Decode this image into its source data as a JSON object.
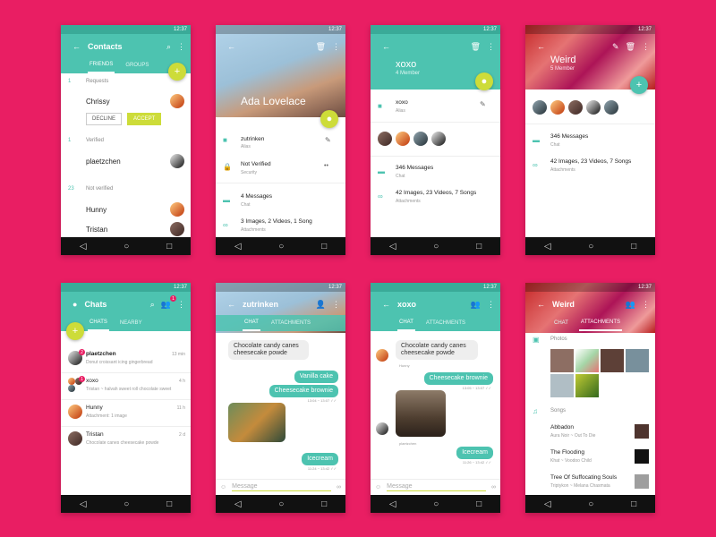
{
  "colors": {
    "bg": "#E91E63",
    "primary": "#4DC3B0",
    "accent": "#CDDC39",
    "nav": "#111111"
  },
  "time": "12:37",
  "nav": {
    "back": "◁",
    "home": "○",
    "recent": "□"
  },
  "s1": {
    "title": "Contacts",
    "tabs": [
      "FRIENDS",
      "GROUPS"
    ],
    "req_count": "1",
    "req_label": "Requests",
    "req_name": "Chrissy",
    "decline": "DECLINE",
    "accept": "ACCEPT",
    "ver_count": "1",
    "ver_label": "Verified",
    "ver_name": "plaetzchen",
    "nv_count": "23",
    "nv_label": "Not verified",
    "nv_names": [
      "Hunny",
      "Tristan"
    ]
  },
  "s2": {
    "name": "Ada Lovelace",
    "rows": [
      {
        "t": "zutrinken",
        "s": "Alias"
      },
      {
        "t": "Not Verified",
        "s": "Security"
      },
      {
        "t": "4 Messages",
        "s": "Chat"
      },
      {
        "t": "3 Images, 2 Videos, 1 Song",
        "s": "Attachments"
      }
    ]
  },
  "s3": {
    "title": "xoxo",
    "sub": "4 Member",
    "alias": {
      "t": "xoxo",
      "s": "Alias"
    },
    "chat": {
      "t": "346 Messages",
      "s": "Chat"
    },
    "att": {
      "t": "42 Images, 23 Videos, 7 Songs",
      "s": "Attachments"
    }
  },
  "s4": {
    "title": "Weird",
    "sub": "5 Member",
    "chat": {
      "t": "346 Messages",
      "s": "Chat"
    },
    "att": {
      "t": "42 Images, 23 Videos, 7 Songs",
      "s": "Attachments"
    }
  },
  "s5": {
    "title": "Chats",
    "tabs": [
      "CHATS",
      "NEARBY"
    ],
    "badge": "1",
    "items": [
      {
        "name": "plaetzchen",
        "msg": "Donut croissant icing gingerbread",
        "time": "13 min",
        "badge": "2"
      },
      {
        "name": "xoxo",
        "msg": "Tristan ~ halvah sweet roll chocolate sweet",
        "time": "4 h",
        "badge": "1"
      },
      {
        "name": "Hunny",
        "msg": "Attachment: 1 image",
        "time": "11 h",
        "badge": ""
      },
      {
        "name": "Tristan",
        "msg": "Chocolate canes cheesecake powde",
        "time": "2 d",
        "badge": ""
      }
    ]
  },
  "s6": {
    "title": "zutrinken",
    "tabs": [
      "CHAT",
      "ATTACHMENTS"
    ],
    "msgs": {
      "m1": "Chocolate candy canes cheesecake powde",
      "m2": "Vanilla cake",
      "m3": "Cheesecake brownie",
      "t3": "13:04 ~ 13:07 ✓✓",
      "t4": "11:24 ~ 13:42 ✓✓",
      "m4": "Icecream"
    },
    "placeholder": "Message"
  },
  "s7": {
    "title": "xoxo",
    "tabs": [
      "CHAT",
      "ATTACHMENTS"
    ],
    "msgs": {
      "m1": "Chocolate candy canes cheesecake powde",
      "who1": "Hunny",
      "m2": "Cheesecake brownie",
      "t2": "13:05 ~ 13:07 ✓✓",
      "who2": "plaetzchen",
      "m3": "Icecream",
      "t3": "11:26 ~ 13:42 ✓✓"
    },
    "placeholder": "Message"
  },
  "s8": {
    "title": "Weird",
    "tabs": [
      "CHAT",
      "ATTACHMENTS"
    ],
    "photos": "Photos",
    "songs_label": "Songs",
    "songs": [
      {
        "t": "Abbadon",
        "s": "Aura Noir ~ Out To Die"
      },
      {
        "t": "The Flooding",
        "s": "Khat ~ Voodoo Child"
      },
      {
        "t": "Tree Of Suffocating Souls",
        "s": "Triptykon ~ Melana Chasmata"
      }
    ]
  }
}
